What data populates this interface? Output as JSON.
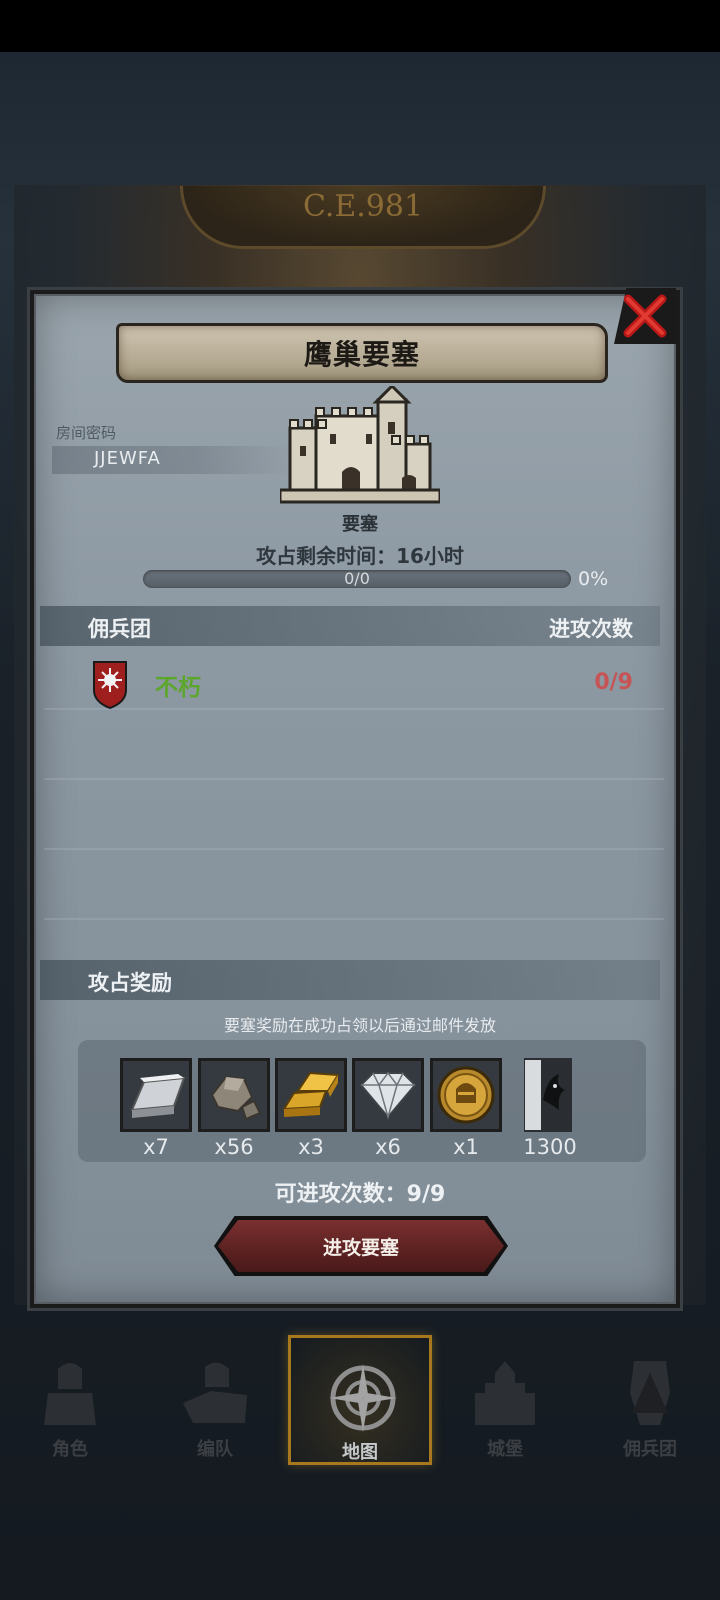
{
  "map": {
    "era_label": "C.E.981"
  },
  "dialog": {
    "title": "鹰巢要塞",
    "room_code_label": "房间密码",
    "room_code": "JJEWFA",
    "building_label": "要塞",
    "time_text": "攻占剩余时间：16小时",
    "progress": {
      "text": "0/0",
      "percent_text": "0%",
      "fraction": 0
    },
    "mercenary_section": {
      "header_left": "佣兵团",
      "header_right": "进攻次数",
      "rows": [
        {
          "name": "不朽",
          "count": "0/9"
        }
      ]
    },
    "reward_section": {
      "header": "攻占奖励",
      "note": "要塞奖励在成功占领以后通过邮件发放",
      "items": [
        {
          "icon": "silver-ingot-icon",
          "qty": "x7"
        },
        {
          "icon": "stone-icon",
          "qty": "x56"
        },
        {
          "icon": "gold-ingot-icon",
          "qty": "x3"
        },
        {
          "icon": "diamond-icon",
          "qty": "x6"
        },
        {
          "icon": "knight-coin-icon",
          "qty": "x1"
        },
        {
          "icon": "guild-banner-icon",
          "qty": "1300"
        }
      ]
    },
    "attack_count_text": "可进攻次数：9/9",
    "attack_button": "进攻要塞"
  },
  "nav": {
    "items": [
      {
        "label": "角色",
        "icon": "character-icon"
      },
      {
        "label": "编队",
        "icon": "formation-icon"
      },
      {
        "label": "地图",
        "icon": "compass-icon",
        "active": true
      },
      {
        "label": "城堡",
        "icon": "castle-icon"
      },
      {
        "label": "佣兵团",
        "icon": "mercenary-icon"
      }
    ]
  },
  "colors": {
    "guild_name": "#5da62e",
    "count_red": "#c75455",
    "accent": "#a8781f"
  }
}
